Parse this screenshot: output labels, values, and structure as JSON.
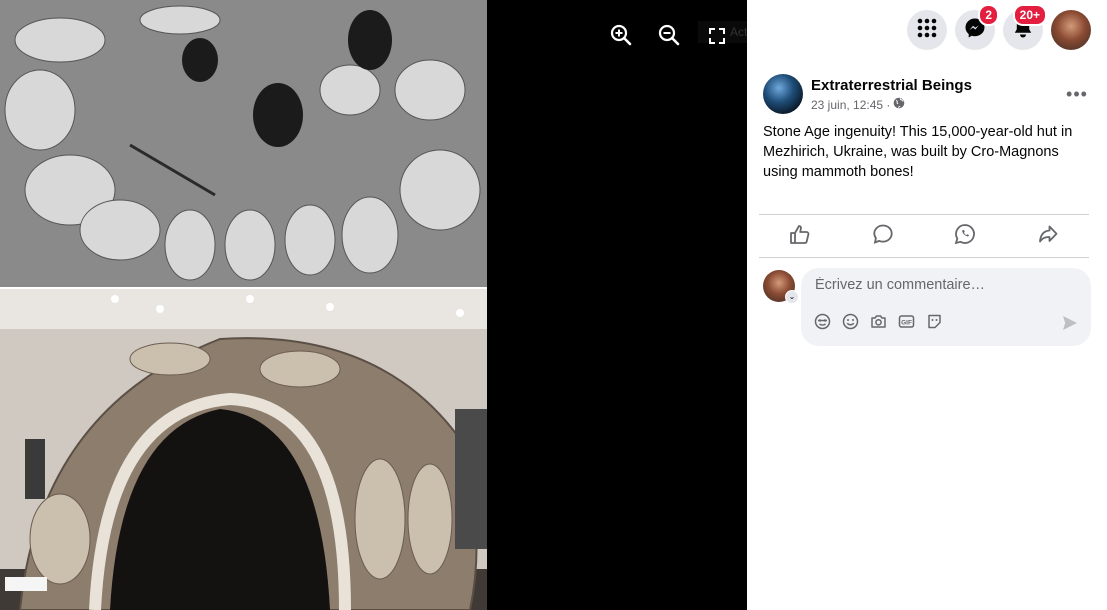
{
  "viewer": {
    "fullscreen_tooltip": "Activer Plein écran",
    "photos": [
      "mammoth-bone-excavation-photo",
      "mammoth-bone-hut-reconstruction-photo"
    ]
  },
  "topbar": {
    "messenger_badge": "2",
    "notifications_badge": "20+"
  },
  "post": {
    "page_name": "Extraterrestrial Beings",
    "date": "23 juin, 12:45 ·",
    "text": "Stone Age ingenuity! This 15,000-year-old hut in Mezhirich, Ukraine, was built by Cro-Magnons using mammoth bones!"
  },
  "comment": {
    "placeholder": "Écrivez un commentaire…"
  }
}
